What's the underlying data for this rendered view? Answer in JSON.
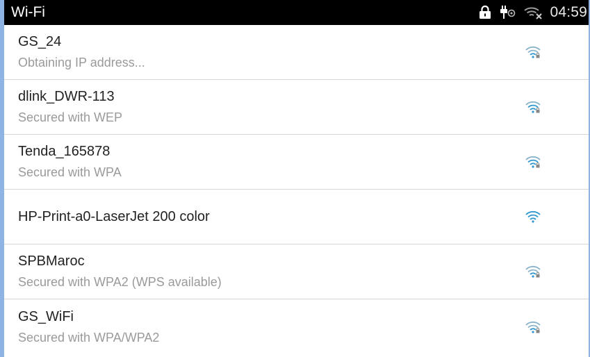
{
  "statusbar": {
    "title": "Wi-Fi",
    "time": "04:59",
    "icons": [
      "lock-icon",
      "usb-debug-icon",
      "wifi-off-icon"
    ]
  },
  "networks": [
    {
      "name": "GS_24",
      "status": "Obtaining IP address...",
      "secured": true,
      "icon": "wifi-locked-icon"
    },
    {
      "name": "dlink_DWR-113",
      "status": "Secured with WEP",
      "secured": true,
      "icon": "wifi-locked-icon"
    },
    {
      "name": "Tenda_165878",
      "status": "Secured with WPA",
      "secured": true,
      "icon": "wifi-locked-icon"
    },
    {
      "name": "HP-Print-a0-LaserJet 200 color",
      "status": "",
      "secured": false,
      "icon": "wifi-open-icon"
    },
    {
      "name": "SPBMaroc",
      "status": "Secured with WPA2 (WPS available)",
      "secured": true,
      "icon": "wifi-locked-icon"
    },
    {
      "name": "GS_WiFi",
      "status": "Secured with WPA/WPA2",
      "secured": true,
      "icon": "wifi-locked-icon"
    }
  ],
  "colors": {
    "statusbar_bg": "#000000",
    "wifi_icon": "#2f96cf",
    "divider": "#d7d7d7",
    "frame_border": "#8fb4e3"
  }
}
